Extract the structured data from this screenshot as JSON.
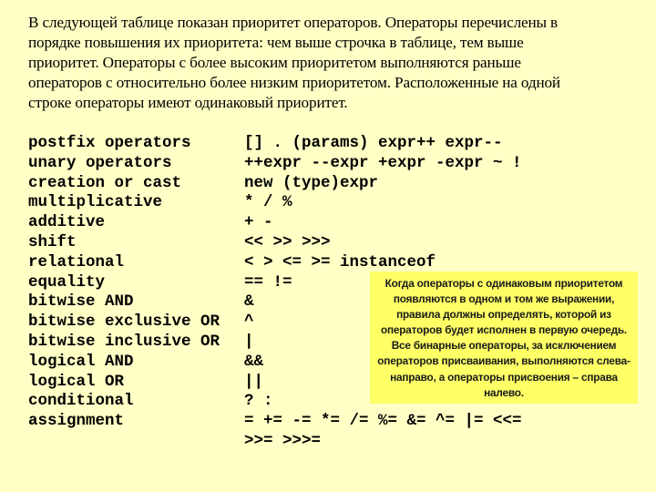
{
  "intro": {
    "lines": [
      "В следующей таблице показан приоритет операторов. Операторы перечислены в",
      "порядке повышения их приоритета: чем выше строчка в таблице, тем выше",
      "приоритет. Операторы с более высоким приоритетом выполняются раньше",
      "операторов с относительно более низким приоритетом. Расположенные на одной",
      "строке операторы имеют одинаковый приоритет."
    ]
  },
  "precedence_table": {
    "rows": [
      {
        "name": "postfix operators",
        "ops": "[] . (params) expr++ expr--"
      },
      {
        "name": "unary operators",
        "ops": "++expr --expr +expr -expr ~ !"
      },
      {
        "name": "creation or cast",
        "ops": "new (type)expr"
      },
      {
        "name": "multiplicative",
        "ops": "* / %"
      },
      {
        "name": "additive",
        "ops": "+ -"
      },
      {
        "name": "shift",
        "ops": "<< >> >>>"
      },
      {
        "name": "relational",
        "ops": "< > <= >= instanceof"
      },
      {
        "name": "equality",
        "ops": "== !="
      },
      {
        "name": "bitwise AND",
        "ops": "&"
      },
      {
        "name": "bitwise exclusive OR",
        "ops": "^"
      },
      {
        "name": "bitwise inclusive OR",
        "ops": "|"
      },
      {
        "name": "logical AND",
        "ops": "&&"
      },
      {
        "name": "logical OR",
        "ops": "||"
      },
      {
        "name": "conditional",
        "ops": "? :"
      },
      {
        "name": "assignment",
        "ops": "= += -= *= /= %= &= ^= |= <<="
      },
      {
        "name": "",
        "ops": ">>= >>>="
      }
    ]
  },
  "note": {
    "background": "#ffff66",
    "lines": [
      "Когда операторы с одинаковым приоритетом",
      "появляются в одном и том же выражении,",
      "правила должны определять, которой из",
      "операторов будет исполнен в первую очередь.",
      "Все бинарные операторы, за исключением",
      "операторов присваивания, выполняются слева-",
      "направо, а операторы присвоения –  справа",
      "налево."
    ]
  }
}
